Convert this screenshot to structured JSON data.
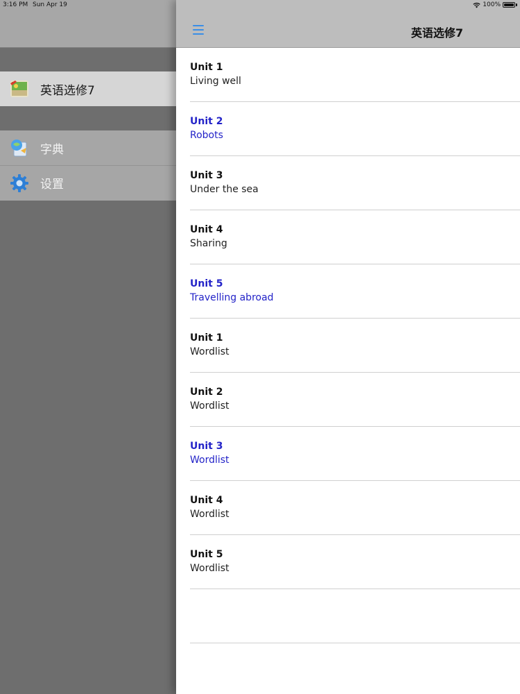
{
  "status_bar": {
    "time": "3:16 PM",
    "date": "Sun Apr 19",
    "battery": "100%"
  },
  "sidebar": {
    "book": {
      "label": "英语选修7",
      "icon": "book-cover-icon"
    },
    "items": [
      {
        "label": "字典",
        "icon": "dictionary-icon"
      },
      {
        "label": "设置",
        "icon": "gear-icon"
      }
    ]
  },
  "navbar": {
    "title": "英语选修7",
    "menu_icon": "menu-icon"
  },
  "list": [
    {
      "title": "Unit 1",
      "subtitle": "Living well",
      "highlight": false
    },
    {
      "title": "Unit 2",
      "subtitle": "Robots",
      "highlight": true
    },
    {
      "title": "Unit 3",
      "subtitle": "Under the sea",
      "highlight": false
    },
    {
      "title": "Unit 4",
      "subtitle": "Sharing",
      "highlight": false
    },
    {
      "title": "Unit 5",
      "subtitle": "Travelling abroad",
      "highlight": true
    },
    {
      "title": "Unit 1",
      "subtitle": "Wordlist",
      "highlight": false
    },
    {
      "title": "Unit 2",
      "subtitle": "Wordlist",
      "highlight": false
    },
    {
      "title": "Unit 3",
      "subtitle": "Wordlist",
      "highlight": true
    },
    {
      "title": "Unit 4",
      "subtitle": "Wordlist",
      "highlight": false
    },
    {
      "title": "Unit 5",
      "subtitle": "Wordlist",
      "highlight": false
    },
    {
      "title": "",
      "subtitle": "",
      "highlight": false
    }
  ],
  "colors": {
    "highlight": "#2323c8",
    "menu_icon": "#3a8ee6"
  }
}
